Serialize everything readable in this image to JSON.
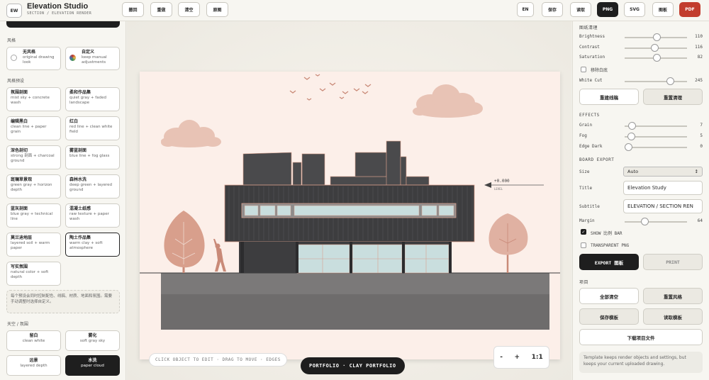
{
  "app": {
    "logo": "EW",
    "name": "Elevation Studio",
    "subtitle": "SECTION / ELEVATION RENDER"
  },
  "toolbar": {
    "left": [
      "撤回",
      "重做",
      "清空",
      "原图"
    ],
    "right": [
      "EN",
      "保存",
      "读取",
      "PNG",
      "SVG",
      "图板",
      "PDF"
    ]
  },
  "left": {
    "style_section": "风格",
    "style_cards": [
      {
        "title": "无风格",
        "desc": "original drawing look"
      },
      {
        "title": "自定义",
        "desc": "keep manual adjustments"
      }
    ],
    "preset_section": "风格预设",
    "presets": [
      {
        "title": "氛围剖面",
        "desc": "mist sky + concrete wash"
      },
      {
        "title": "柔和作品集",
        "desc": "quiet gray + faded landscape"
      },
      {
        "title": "编辑黑白",
        "desc": "clean line + paper grain"
      },
      {
        "title": "红白",
        "desc": "red line + clean white field"
      },
      {
        "title": "深色剖切",
        "desc": "strong 剖面 + charcoal ground"
      },
      {
        "title": "雾蓝剖面",
        "desc": "blue line + fog glass"
      },
      {
        "title": "斑斓草景观",
        "desc": "green gray + horizon depth"
      },
      {
        "title": "森林水洗",
        "desc": "deep green + layered ground"
      },
      {
        "title": "蓝灰剖面",
        "desc": "blue gray + technical line"
      },
      {
        "title": "混凝土纸感",
        "desc": "raw texture + paper wash"
      },
      {
        "title": "莫兰迪地层",
        "desc": "layered soil + warm paper"
      },
      {
        "title": "陶土作品集",
        "desc": "warm clay + soft atmosphere"
      },
      {
        "title": "写实氛围",
        "desc": "natural color + soft depth"
      }
    ],
    "preset_note": "每个预设会同时控制配色、线稿、材质、地面和氛围。需要手动调整时选择自定义。",
    "sky_section": "天空 / 氛围",
    "sky_cards": [
      {
        "title": "留白",
        "desc": "clean white"
      },
      {
        "title": "雾化",
        "desc": "soft gray sky"
      },
      {
        "title": "远景",
        "desc": "layered depth"
      },
      {
        "title": "水洗",
        "desc": "paper cloud"
      }
    ]
  },
  "canvas": {
    "level_label": "+0.000",
    "level_sub": "LEVEL",
    "hint": "CLICK OBJECT TO EDIT · DRAG TO MOVE · EDGES",
    "mode_pill": "PORTFOLIO · CLAY PORTFOLIO",
    "zoom_minus": "-",
    "zoom_plus": "+",
    "zoom_fit": "1:1"
  },
  "right": {
    "cleanup_head": "图纸清理",
    "brightness": {
      "label": "Brightness",
      "value": "110",
      "fraction": 0.52
    },
    "contrast": {
      "label": "Contrast",
      "value": "116",
      "fraction": 0.48
    },
    "saturation": {
      "label": "Saturation",
      "value": "82",
      "fraction": 0.52
    },
    "remove_white": "移除白底",
    "white_cut": {
      "label": "White Cut",
      "value": "245",
      "fraction": 0.76
    },
    "rebuild_btn": "重建线稿",
    "reset_clean_btn": "重置清理",
    "effects_head": "EFFECTS",
    "grain": {
      "label": "Grain",
      "value": "7",
      "fraction": 0.07
    },
    "fog": {
      "label": "Fog",
      "value": "5",
      "fraction": 0.05
    },
    "edge_dark": {
      "label": "Edge Dark",
      "value": "0",
      "fraction": 0.0
    },
    "board_head": "BOARD EXPORT",
    "size_label": "Size",
    "size_value": "Auto",
    "title_label": "Title",
    "title_value": "Elevation Study",
    "subtitle_label": "Subtitle",
    "subtitle_value": "ELEVATION / SECTION REN",
    "margin": {
      "label": "Margin",
      "value": "64",
      "fraction": 0.3
    },
    "show_scale": "SHOW 比例 BAR",
    "transparent": "TRANSPARENT PNG",
    "export_btn": "EXPORT 图板",
    "print_btn": "PRINT",
    "project_head": "项目",
    "clear_all": "全部清空",
    "reset_style": "重置风格",
    "save_template": "保存模板",
    "load_template": "读取模板",
    "download_project": "下载项目文件",
    "template_note": "Template keeps render objects and settings, but keeps your current uploaded drawing."
  },
  "colors": {
    "accent_dark": "#1e1e1e",
    "pdf_red": "#c23d2e",
    "paper": "#fcefe9",
    "clay": "#d89f8c",
    "facade": "#3d3d3f",
    "glass": "#c9dede"
  }
}
